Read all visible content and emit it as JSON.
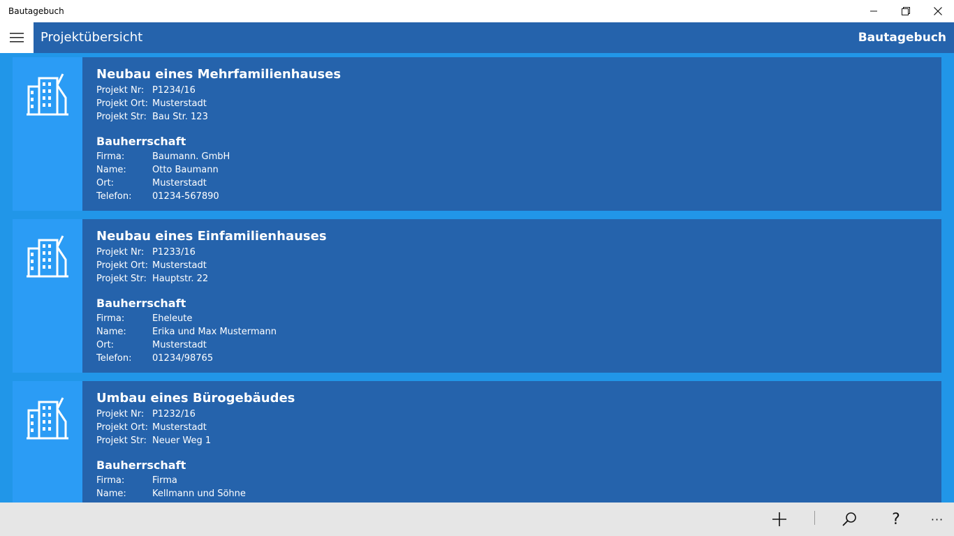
{
  "window": {
    "title": "Bautagebuch",
    "minimize_label": "—",
    "restore_label": "❐",
    "close_label": "✕"
  },
  "header": {
    "page_title": "Projektübersicht",
    "app_name": "Bautagebuch"
  },
  "labels": {
    "projekt_nr": "Projekt Nr:",
    "projekt_ort": "Projekt Ort:",
    "projekt_str": "Projekt Str:",
    "bauherrschaft": "Bauherrschaft",
    "firma": "Firma:",
    "name": "Name:",
    "ort": "Ort:",
    "telefon": "Telefon:"
  },
  "projects": [
    {
      "title": "Neubau eines Mehrfamilienhauses",
      "nr": "P1234/16",
      "ort": "Musterstadt",
      "str": "Bau Str. 123",
      "client_firma": "Baumann. GmbH",
      "client_name": "Otto Baumann",
      "client_ort": "Musterstadt",
      "client_telefon": "01234-567890"
    },
    {
      "title": "Neubau eines Einfamilienhauses",
      "nr": "P1233/16",
      "ort": "Musterstadt",
      "str": "Hauptstr. 22",
      "client_firma": "Eheleute",
      "client_name": "Erika und Max Mustermann",
      "client_ort": "Musterstadt",
      "client_telefon": "01234/98765"
    },
    {
      "title": "Umbau eines Bürogebäudes",
      "nr": "P1232/16",
      "ort": "Musterstadt",
      "str": "Neuer Weg 1",
      "client_firma": "Firma",
      "client_name": "Kellmann und Söhne",
      "client_ort": "",
      "client_telefon": ""
    }
  ],
  "commands": {
    "add_icon": "add-icon",
    "search_icon": "search-icon",
    "help_label": "?",
    "more_label": "···"
  },
  "colors": {
    "background": "#2196e8",
    "card": "#2563ac",
    "thumb": "#2b9cf5",
    "commandbar": "#e6e6e6"
  }
}
